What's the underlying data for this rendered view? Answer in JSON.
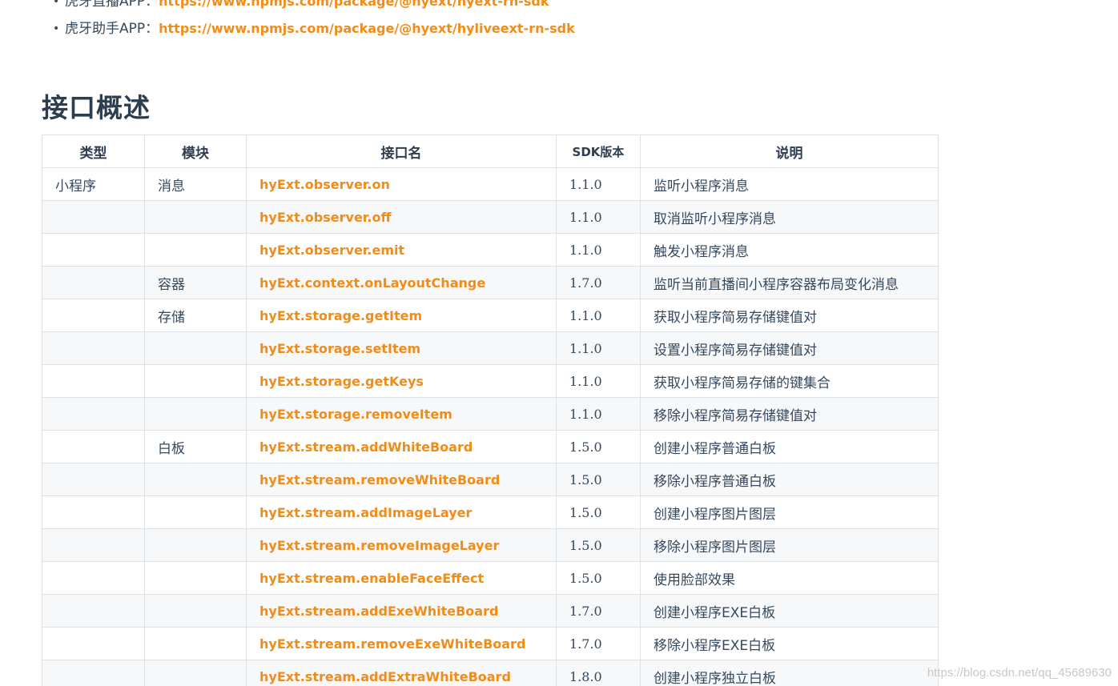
{
  "links": [
    {
      "label": "虎牙直播APP：",
      "url_text": "https://www.npmjs.com/package/@hyext/hyext-rn-sdk"
    },
    {
      "label": "虎牙助手APP：",
      "url_text": "https://www.npmjs.com/package/@hyext/hyliveext-rn-sdk"
    }
  ],
  "section_title": "接口概述",
  "table": {
    "headers": [
      "类型",
      "模块",
      "接口名",
      "SDK版本",
      "说明"
    ],
    "rows": [
      {
        "type": "小程序",
        "module": "消息",
        "api": "hyExt.observer.on",
        "version": "1.1.0",
        "desc": "监听小程序消息"
      },
      {
        "type": "",
        "module": "",
        "api": "hyExt.observer.off",
        "version": "1.1.0",
        "desc": "取消监听小程序消息"
      },
      {
        "type": "",
        "module": "",
        "api": "hyExt.observer.emit",
        "version": "1.1.0",
        "desc": "触发小程序消息"
      },
      {
        "type": "",
        "module": "容器",
        "api": "hyExt.context.onLayoutChange",
        "version": "1.7.0",
        "desc": "监听当前直播间小程序容器布局变化消息"
      },
      {
        "type": "",
        "module": "存储",
        "api": "hyExt.storage.getItem",
        "version": "1.1.0",
        "desc": "获取小程序简易存储键值对"
      },
      {
        "type": "",
        "module": "",
        "api": "hyExt.storage.setItem",
        "version": "1.1.0",
        "desc": "设置小程序简易存储键值对"
      },
      {
        "type": "",
        "module": "",
        "api": "hyExt.storage.getKeys",
        "version": "1.1.0",
        "desc": "获取小程序简易存储的键集合"
      },
      {
        "type": "",
        "module": "",
        "api": "hyExt.storage.removeItem",
        "version": "1.1.0",
        "desc": "移除小程序简易存储键值对"
      },
      {
        "type": "",
        "module": "白板",
        "api": "hyExt.stream.addWhiteBoard",
        "version": "1.5.0",
        "desc": "创建小程序普通白板"
      },
      {
        "type": "",
        "module": "",
        "api": "hyExt.stream.removeWhiteBoard",
        "version": "1.5.0",
        "desc": "移除小程序普通白板"
      },
      {
        "type": "",
        "module": "",
        "api": "hyExt.stream.addImageLayer",
        "version": "1.5.0",
        "desc": "创建小程序图片图层"
      },
      {
        "type": "",
        "module": "",
        "api": "hyExt.stream.removeImageLayer",
        "version": "1.5.0",
        "desc": "移除小程序图片图层"
      },
      {
        "type": "",
        "module": "",
        "api": "hyExt.stream.enableFaceEffect",
        "version": "1.5.0",
        "desc": "使用脸部效果"
      },
      {
        "type": "",
        "module": "",
        "api": "hyExt.stream.addExeWhiteBoard",
        "version": "1.7.0",
        "desc": "创建小程序EXE白板"
      },
      {
        "type": "",
        "module": "",
        "api": "hyExt.stream.removeExeWhiteBoard",
        "version": "1.7.0",
        "desc": "移除小程序EXE白板"
      },
      {
        "type": "",
        "module": "",
        "api": "hyExt.stream.addExtraWhiteBoard",
        "version": "1.8.0",
        "desc": "创建小程序独立白板"
      }
    ]
  },
  "watermark": "https://blog.csdn.net/qq_45689630",
  "colors": {
    "link": "#f28c18",
    "text": "#34495e",
    "heading": "#2c3e50",
    "border": "#dfe2e5",
    "stripe": "#f6f8fa"
  }
}
